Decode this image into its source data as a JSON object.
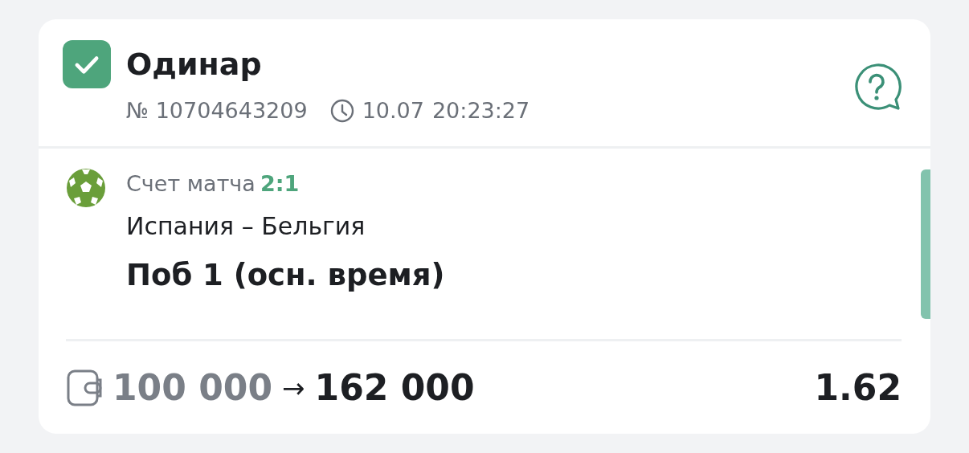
{
  "bet": {
    "type": "Одинар",
    "won": true,
    "number": "№ 10704643209",
    "date": "10.07",
    "time": "20:23:27"
  },
  "event": {
    "kind": "football",
    "score_label": "Счет матча",
    "score": "2:1",
    "teams": "Испания – Бельгия",
    "outcome": "Поб 1 (осн. время)"
  },
  "footer": {
    "stake": "100 000",
    "arrow": "→",
    "payout": "162 000",
    "odds": "1.62"
  }
}
